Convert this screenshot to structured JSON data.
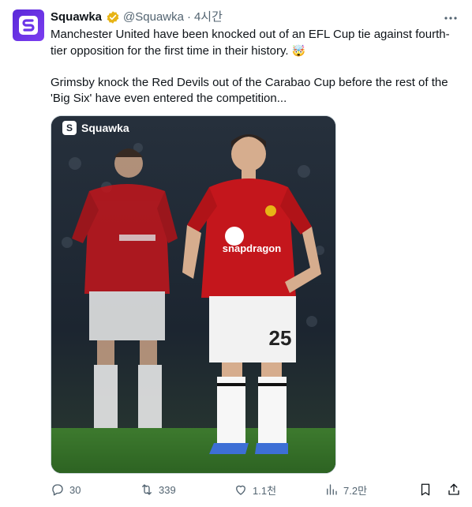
{
  "author": {
    "name": "Squawka",
    "handle": "@Squawka",
    "separator": "·",
    "time": "4시간"
  },
  "tweet": {
    "line1": "Manchester United have been knocked out of an EFL Cup tie against fourth-tier opposition for the first time in their history.",
    "emoji": "🤯",
    "line2": "Grimsby knock the Red Devils out of the Carabao Cup before the rest of the 'Big Six' have even entered the competition..."
  },
  "media": {
    "watermark": "Squawka",
    "shirt_sponsor": "snapdragon",
    "shirt_number": "25"
  },
  "actions": {
    "replies": "30",
    "retweets": "339",
    "likes": "1.1천",
    "views": "7.2만"
  },
  "colors": {
    "brand": "#6b35e8",
    "verified": "#e7b416",
    "muted": "#536471",
    "kit_red": "#c4161c"
  },
  "icons": [
    "verified-badge-icon",
    "more-icon",
    "reply-icon",
    "retweet-icon",
    "like-icon",
    "views-icon",
    "bookmark-icon",
    "share-icon"
  ]
}
